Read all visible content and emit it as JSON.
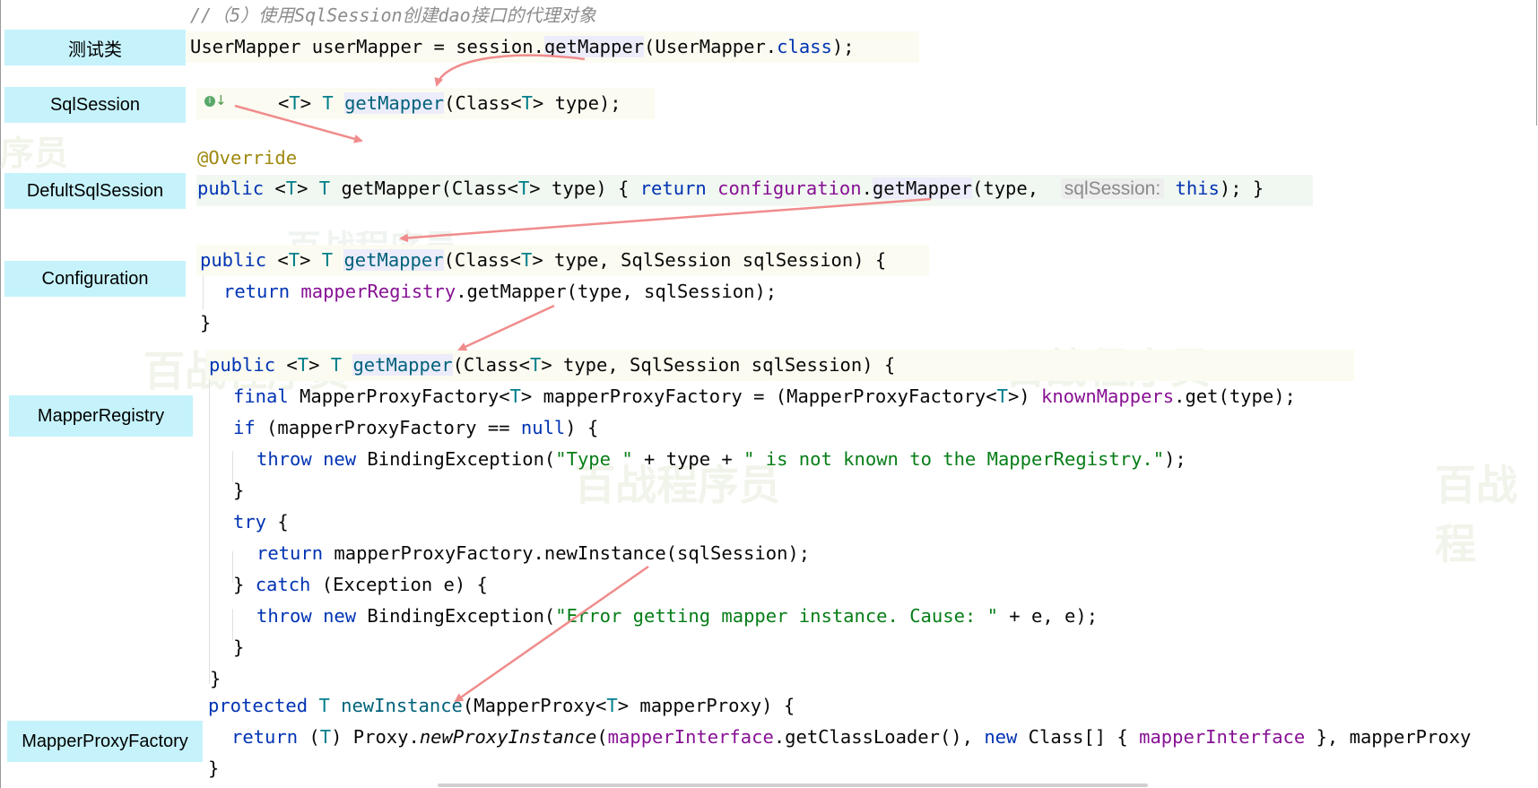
{
  "labels": {
    "test_class": "测试类",
    "sqlsession": "SqlSession",
    "default_sqlsession": "DefultSqlSession",
    "configuration": "Configuration",
    "mapper_registry": "MapperRegistry",
    "mapper_proxy_factory": "MapperProxyFactory"
  },
  "code": {
    "comment": "//（5）使用SqlSession创建dao接口的代理对象",
    "test": {
      "a": "UserMapper userMapper = session.",
      "b": "getMapper",
      "c": "(UserMapper.",
      "d": "class",
      "e": ");"
    },
    "sqlsession": {
      "a": "<",
      "b": "T",
      "c": "> ",
      "d": "T",
      "e": " ",
      "f": "getMapper",
      "g": "(Class<",
      "h": "T",
      "i": "> type);"
    },
    "override": "@Override",
    "default": {
      "a": "public",
      "b": " <",
      "c": "T",
      "d": "> ",
      "e": "T",
      "f": " getMapper(Class<",
      "g": "T",
      "h": "> type) { ",
      "i": "return",
      "j": " ",
      "k": "configuration",
      "l": ".",
      "m": "getMapper",
      "n": "(type,  ",
      "hint": "sqlSession:",
      "o": " ",
      "p": "this",
      "q": "); }"
    },
    "config": {
      "l1a": "public",
      "l1b": " <",
      "l1c": "T",
      "l1d": "> ",
      "l1e": "T",
      "l1f": " ",
      "l1g": "getMapper",
      "l1h": "(Class<",
      "l1i": "T",
      "l1j": "> type, SqlSession sqlSession) {",
      "l2a": "return",
      "l2b": " ",
      "l2c": "mapperRegistry",
      "l2d": ".getMapper(type, sqlSession);",
      "l3": "}"
    },
    "registry": {
      "l1a": "public",
      "l1b": " <",
      "l1c": "T",
      "l1d": "> ",
      "l1e": "T",
      "l1f": " ",
      "l1g": "getMapper",
      "l1h": "(Class<",
      "l1i": "T",
      "l1j": "> type, SqlSession sqlSession) {",
      "l2a": "final",
      "l2b": " MapperProxyFactory<",
      "l2c": "T",
      "l2d": "> mapperProxyFactory = (MapperProxyFactory<",
      "l2e": "T",
      "l2f": ">) ",
      "l2g": "knownMappers",
      "l2h": ".get(type);",
      "l3a": "if",
      "l3b": " (mapperProxyFactory == ",
      "l3c": "null",
      "l3d": ") {",
      "l4a": "throw",
      "l4b": " ",
      "l4c": "new",
      "l4d": " BindingException(",
      "l4e": "\"Type \"",
      "l4f": " + type + ",
      "l4g": "\" is not known to the MapperRegistry.\"",
      "l4h": ");",
      "l5": "}",
      "l6a": "try",
      "l6b": " {",
      "l7a": "return",
      "l7b": " mapperProxyFactory.newInstance(sqlSession);",
      "l8a": "} ",
      "l8b": "catch",
      "l8c": " (Exception e) {",
      "l9a": "throw",
      "l9b": " ",
      "l9c": "new",
      "l9d": " BindingException(",
      "l9e": "\"Error getting mapper instance. Cause: \"",
      "l9f": " + e, e);",
      "l10": "}",
      "l11": "}"
    },
    "factory": {
      "l1a": "protected",
      "l1b": " ",
      "l1c": "T",
      "l1d": " ",
      "l1e": "newInstance",
      "l1f": "(MapperProxy<",
      "l1g": "T",
      "l1h": "> mapperProxy) {",
      "l2a": "return",
      "l2b": " (",
      "l2c": "T",
      "l2d": ") Proxy.",
      "l2e": "newProxyInstance",
      "l2f": "(",
      "l2g": "mapperInterface",
      "l2h": ".getClassLoader(), ",
      "l2i": "new",
      "l2j": " Class[] { ",
      "l2k": "mapperInterface",
      "l2l": " }, mapperProxy",
      "l3": "}"
    }
  },
  "watermarks": [
    "百战程序员",
    "百战程序员",
    "百战程序员",
    "百战程序员",
    "百战程",
    "序员"
  ],
  "colors": {
    "label_bg": "#c6f3fb",
    "keyword": "#0033b3",
    "method": "#00627a",
    "field": "#871094",
    "string": "#067d17",
    "annotation": "#9e880d",
    "arrow": "#f08c8c"
  },
  "icons": {
    "gutter": "implementation-down-arrow-icon"
  }
}
